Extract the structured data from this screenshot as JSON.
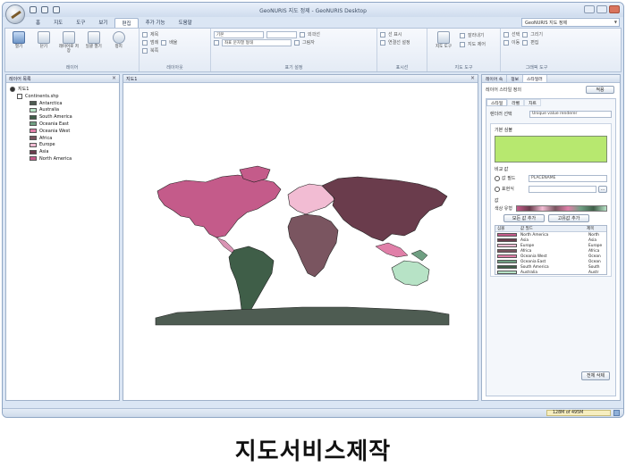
{
  "window": {
    "title": "GeoNURIS 지도 정제 - GeoNURIS Desktop",
    "right_selector": "GeoNURIS 지도 정제"
  },
  "ribbon_tabs": [
    "홈",
    "지도",
    "도구",
    "보기",
    "편집",
    "추가 기능",
    "도움말"
  ],
  "ribbon": {
    "groups": [
      {
        "label": "레이어",
        "buttons": [
          "열기",
          "닫기",
          "레이어로 저장",
          "일괄 열기",
          "정지"
        ]
      },
      {
        "label": "레이아웃",
        "items": [
          "제목",
          "범례",
          "배율",
          "북쪽",
          "레이아웃 페이지"
        ]
      },
      {
        "label": "표기 설정",
        "items": [
          "기본",
          "표기 필드",
          "좌표 문자열 형태",
          "외곽선",
          "그림자"
        ]
      },
      {
        "label": "표시선",
        "items": [
          "선 표시",
          "연결선 설정"
        ]
      },
      {
        "label": "지도 도구",
        "items": [
          "지도 도구",
          "잘라내기",
          "지도 제어"
        ]
      },
      {
        "label": "그래픽 도구",
        "items": [
          "선택",
          "그리기",
          "이동",
          "편집"
        ]
      }
    ]
  },
  "left_panel": {
    "title": "레이어 목록",
    "root": "지도1",
    "layer": "Continents.shp",
    "legend": [
      {
        "label": "Antarctica",
        "color": "#4e5c52"
      },
      {
        "label": "Australia",
        "color": "#b7e3c6"
      },
      {
        "label": "South America",
        "color": "#3f5e48"
      },
      {
        "label": "Oceania East",
        "color": "#6f9f82"
      },
      {
        "label": "Oceania West",
        "color": "#e07fa8"
      },
      {
        "label": "Africa",
        "color": "#7a5560"
      },
      {
        "label": "Europe",
        "color": "#f2bcd3"
      },
      {
        "label": "Asia",
        "color": "#6a3c4c"
      },
      {
        "label": "North America",
        "color": "#c45b8a"
      }
    ]
  },
  "map_tab": "지도1",
  "right_panel": {
    "tabs": [
      "레이어 속",
      "정보",
      "스타일러"
    ],
    "header": "레이어 스타일 정의",
    "apply_button": "적용",
    "subtabs": [
      "스타일",
      "라벨",
      "차트"
    ],
    "renderer_label": "렌더러 선택",
    "renderer_value": "Unique value renderer",
    "default_symbol_label": "기본 심볼",
    "default_symbol_color": "#b7e86f",
    "compare_label": "비교 값",
    "field_option": "값 필드",
    "field_value": "PLACENAME",
    "expression_option": "표현식",
    "values_label": "값",
    "color_scheme_label": "색상 유형",
    "add_button": "모든 값 추가",
    "add_unique_button": "고유값 추가",
    "table_headers": [
      "심볼",
      "값 필드",
      "제목"
    ],
    "rows": [
      {
        "value": "North America",
        "title": "North",
        "color": "#c45b8a"
      },
      {
        "value": "Asia",
        "title": "Asia",
        "color": "#6a3c4c"
      },
      {
        "value": "Europe",
        "title": "Europe",
        "color": "#f2bcd3"
      },
      {
        "value": "Africa",
        "title": "Africa",
        "color": "#7a5560"
      },
      {
        "value": "Oceania West",
        "title": "Ocean",
        "color": "#e07fa8"
      },
      {
        "value": "Oceania East",
        "title": "Ocean",
        "color": "#6f9f82"
      },
      {
        "value": "South America",
        "title": "South",
        "color": "#3f5e48"
      },
      {
        "value": "Australia",
        "title": "Austr",
        "color": "#b7e3c6"
      }
    ],
    "delete_all_button": "전체 삭제"
  },
  "status": {
    "memory": "128M of 495M"
  },
  "caption": "지도서비스제작"
}
